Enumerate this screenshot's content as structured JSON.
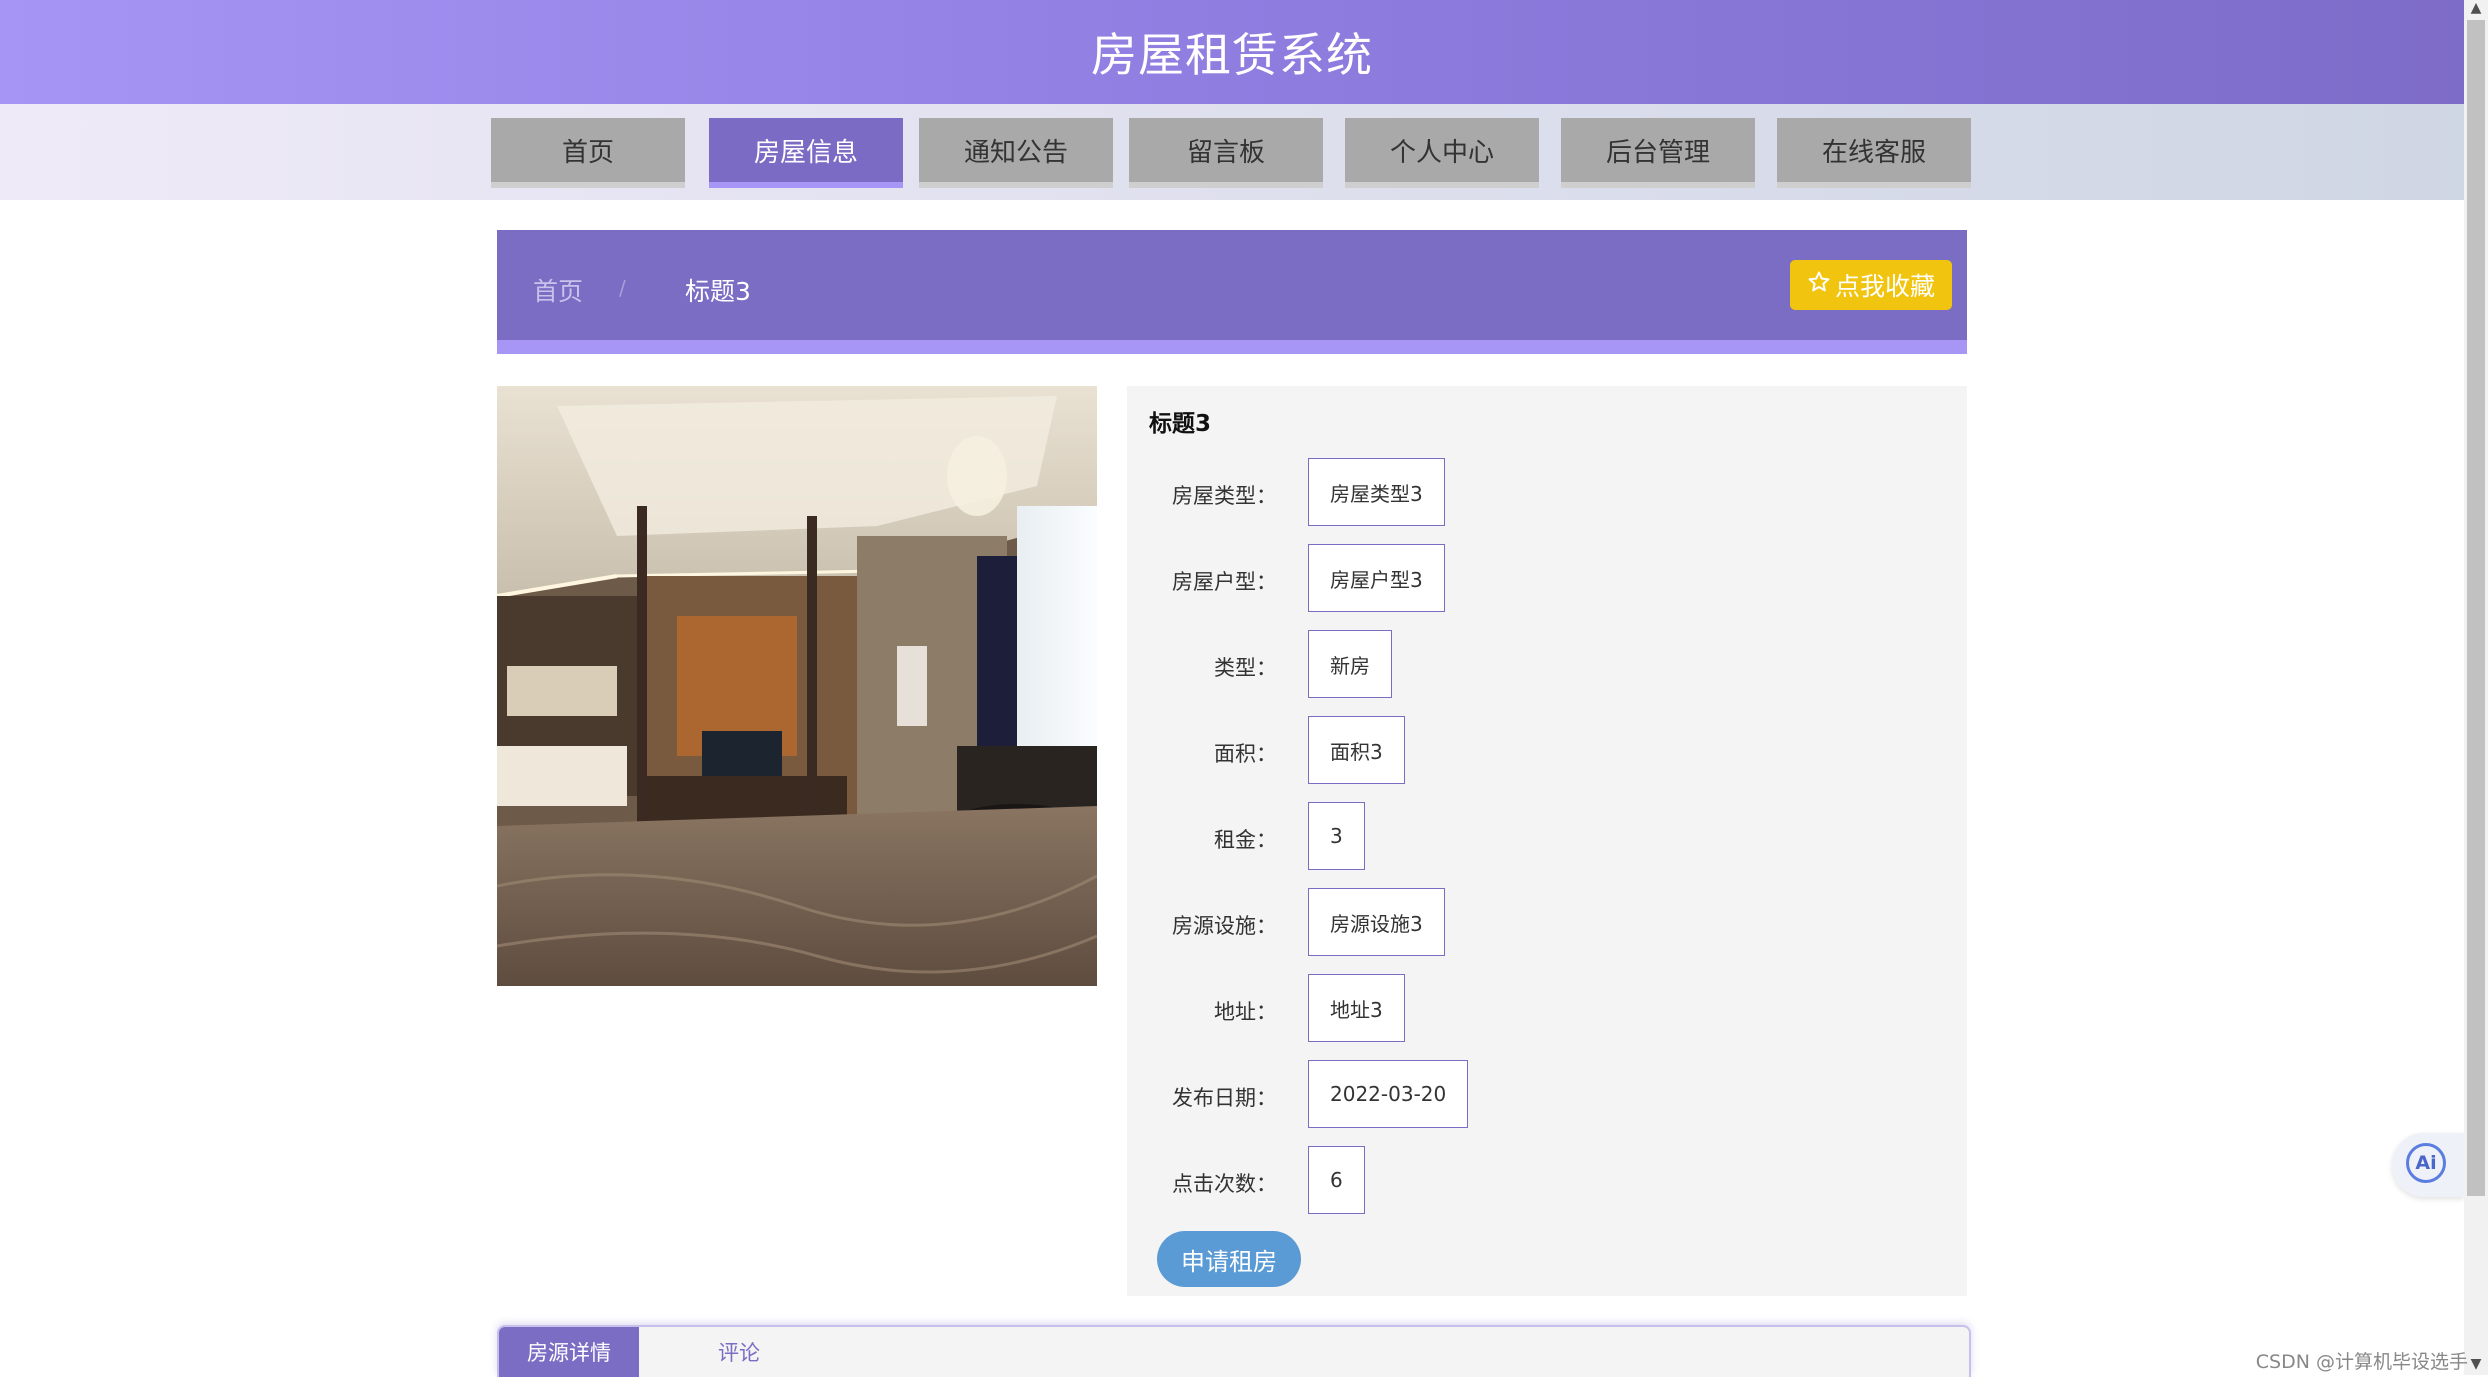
{
  "header": {
    "title": "房屋租赁系统"
  },
  "nav": {
    "items": [
      {
        "label": "首页"
      },
      {
        "label": "房屋信息"
      },
      {
        "label": "通知公告"
      },
      {
        "label": "留言板"
      },
      {
        "label": "个人中心"
      },
      {
        "label": "后台管理"
      },
      {
        "label": "在线客服"
      }
    ],
    "active": "房屋信息"
  },
  "breadcrumb": {
    "home": "首页",
    "separator": "/",
    "current": "标题3"
  },
  "favorite_button": {
    "icon": "star-outline-icon",
    "label": "点我收藏"
  },
  "detail": {
    "title": "标题3",
    "fields": [
      {
        "label": "房屋类型：",
        "value": "房屋类型3"
      },
      {
        "label": "房屋户型：",
        "value": "房屋户型3"
      },
      {
        "label": "类型：",
        "value": "新房"
      },
      {
        "label": "面积：",
        "value": "面积3"
      },
      {
        "label": "租金：",
        "value": "3"
      },
      {
        "label": "房源设施：",
        "value": "房源设施3"
      },
      {
        "label": "地址：",
        "value": "地址3"
      },
      {
        "label": "发布日期：",
        "value": "2022-03-20"
      },
      {
        "label": "点击次数：",
        "value": "6"
      }
    ],
    "apply_button": "申请租房"
  },
  "tabs": [
    {
      "label": "房源详情"
    },
    {
      "label": "评论"
    }
  ],
  "ai_button": {
    "label": "Ai"
  },
  "watermark": "CSDN @计算机毕设选手",
  "colors": {
    "primary": "#7b6cc4",
    "accent": "#a796f5",
    "favorite": "#f1c40f",
    "apply": "#5b9bd5"
  }
}
